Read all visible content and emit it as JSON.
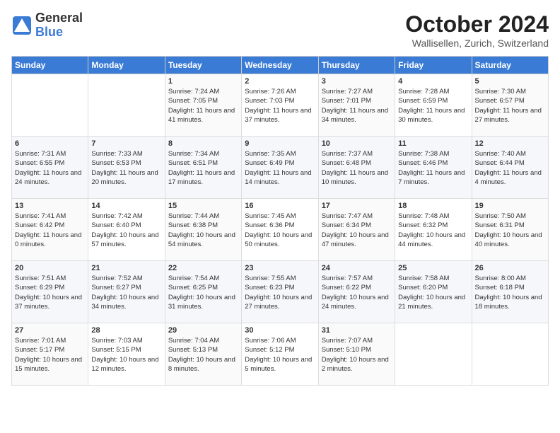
{
  "header": {
    "logo": {
      "general": "General",
      "blue": "Blue"
    },
    "title": "October 2024",
    "subtitle": "Wallisellen, Zurich, Switzerland"
  },
  "weekdays": [
    "Sunday",
    "Monday",
    "Tuesday",
    "Wednesday",
    "Thursday",
    "Friday",
    "Saturday"
  ],
  "weeks": [
    [
      {
        "day": "",
        "info": ""
      },
      {
        "day": "",
        "info": ""
      },
      {
        "day": "1",
        "info": "Sunrise: 7:24 AM\nSunset: 7:05 PM\nDaylight: 11 hours and 41 minutes."
      },
      {
        "day": "2",
        "info": "Sunrise: 7:26 AM\nSunset: 7:03 PM\nDaylight: 11 hours and 37 minutes."
      },
      {
        "day": "3",
        "info": "Sunrise: 7:27 AM\nSunset: 7:01 PM\nDaylight: 11 hours and 34 minutes."
      },
      {
        "day": "4",
        "info": "Sunrise: 7:28 AM\nSunset: 6:59 PM\nDaylight: 11 hours and 30 minutes."
      },
      {
        "day": "5",
        "info": "Sunrise: 7:30 AM\nSunset: 6:57 PM\nDaylight: 11 hours and 27 minutes."
      }
    ],
    [
      {
        "day": "6",
        "info": "Sunrise: 7:31 AM\nSunset: 6:55 PM\nDaylight: 11 hours and 24 minutes."
      },
      {
        "day": "7",
        "info": "Sunrise: 7:33 AM\nSunset: 6:53 PM\nDaylight: 11 hours and 20 minutes."
      },
      {
        "day": "8",
        "info": "Sunrise: 7:34 AM\nSunset: 6:51 PM\nDaylight: 11 hours and 17 minutes."
      },
      {
        "day": "9",
        "info": "Sunrise: 7:35 AM\nSunset: 6:49 PM\nDaylight: 11 hours and 14 minutes."
      },
      {
        "day": "10",
        "info": "Sunrise: 7:37 AM\nSunset: 6:48 PM\nDaylight: 11 hours and 10 minutes."
      },
      {
        "day": "11",
        "info": "Sunrise: 7:38 AM\nSunset: 6:46 PM\nDaylight: 11 hours and 7 minutes."
      },
      {
        "day": "12",
        "info": "Sunrise: 7:40 AM\nSunset: 6:44 PM\nDaylight: 11 hours and 4 minutes."
      }
    ],
    [
      {
        "day": "13",
        "info": "Sunrise: 7:41 AM\nSunset: 6:42 PM\nDaylight: 11 hours and 0 minutes."
      },
      {
        "day": "14",
        "info": "Sunrise: 7:42 AM\nSunset: 6:40 PM\nDaylight: 10 hours and 57 minutes."
      },
      {
        "day": "15",
        "info": "Sunrise: 7:44 AM\nSunset: 6:38 PM\nDaylight: 10 hours and 54 minutes."
      },
      {
        "day": "16",
        "info": "Sunrise: 7:45 AM\nSunset: 6:36 PM\nDaylight: 10 hours and 50 minutes."
      },
      {
        "day": "17",
        "info": "Sunrise: 7:47 AM\nSunset: 6:34 PM\nDaylight: 10 hours and 47 minutes."
      },
      {
        "day": "18",
        "info": "Sunrise: 7:48 AM\nSunset: 6:32 PM\nDaylight: 10 hours and 44 minutes."
      },
      {
        "day": "19",
        "info": "Sunrise: 7:50 AM\nSunset: 6:31 PM\nDaylight: 10 hours and 40 minutes."
      }
    ],
    [
      {
        "day": "20",
        "info": "Sunrise: 7:51 AM\nSunset: 6:29 PM\nDaylight: 10 hours and 37 minutes."
      },
      {
        "day": "21",
        "info": "Sunrise: 7:52 AM\nSunset: 6:27 PM\nDaylight: 10 hours and 34 minutes."
      },
      {
        "day": "22",
        "info": "Sunrise: 7:54 AM\nSunset: 6:25 PM\nDaylight: 10 hours and 31 minutes."
      },
      {
        "day": "23",
        "info": "Sunrise: 7:55 AM\nSunset: 6:23 PM\nDaylight: 10 hours and 27 minutes."
      },
      {
        "day": "24",
        "info": "Sunrise: 7:57 AM\nSunset: 6:22 PM\nDaylight: 10 hours and 24 minutes."
      },
      {
        "day": "25",
        "info": "Sunrise: 7:58 AM\nSunset: 6:20 PM\nDaylight: 10 hours and 21 minutes."
      },
      {
        "day": "26",
        "info": "Sunrise: 8:00 AM\nSunset: 6:18 PM\nDaylight: 10 hours and 18 minutes."
      }
    ],
    [
      {
        "day": "27",
        "info": "Sunrise: 7:01 AM\nSunset: 5:17 PM\nDaylight: 10 hours and 15 minutes."
      },
      {
        "day": "28",
        "info": "Sunrise: 7:03 AM\nSunset: 5:15 PM\nDaylight: 10 hours and 12 minutes."
      },
      {
        "day": "29",
        "info": "Sunrise: 7:04 AM\nSunset: 5:13 PM\nDaylight: 10 hours and 8 minutes."
      },
      {
        "day": "30",
        "info": "Sunrise: 7:06 AM\nSunset: 5:12 PM\nDaylight: 10 hours and 5 minutes."
      },
      {
        "day": "31",
        "info": "Sunrise: 7:07 AM\nSunset: 5:10 PM\nDaylight: 10 hours and 2 minutes."
      },
      {
        "day": "",
        "info": ""
      },
      {
        "day": "",
        "info": ""
      }
    ]
  ]
}
